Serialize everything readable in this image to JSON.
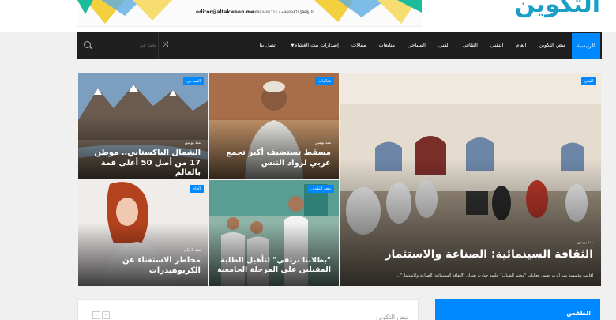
{
  "header": {
    "banner_contact_label": "للتواصل:",
    "banner_email": "editor@altakween.me",
    "banner_phones": "+96894481715 / +96894785904",
    "logo_text": "التكوين"
  },
  "nav": {
    "search_placeholder": "بحث عن",
    "menu": [
      "الرئيسية",
      "نبض التكوين",
      "العام",
      "التقني",
      "الثقافي",
      "الفني",
      "السياحي",
      "متابعات",
      "مقالات",
      "إصدارات بيت الغشام",
      "اتصل بنا"
    ]
  },
  "tiles": {
    "main": {
      "badge": "الفني",
      "date": "منذ يومين",
      "title": "الثقافة السينمائية: الصناعة والاستثمار",
      "excerpt": "أقامت مؤسسة بيت الزبير ضمن فعاليات \"مختبر الشباب\" جلسة حوارية بعنوان \"الثقافة السينمائية: الصناعة والاستثمار\"..."
    },
    "t1": {
      "badge": "فعاليات",
      "date": "منذ يومين",
      "title": "مسقط تستضيف أكبر تجمع عربي لرواد التنس"
    },
    "t2": {
      "badge": "السياحي",
      "date": "منذ يومين",
      "title": "الشمال الباكستاني.. موطن 17 من أصل 50 أعلى قمة بالعالم"
    },
    "t3": {
      "badge": "نبض التكوين",
      "title": "\"بطلابنا نرتقي\" لتأهيل الطلبة المقبلين على المرحلة الجامعية"
    },
    "t4": {
      "badge": "العام",
      "date": "منذ 3 أيام",
      "title": "مخاطر الاستغناء عن الكربوهيدرات"
    }
  },
  "bottom": {
    "block_title": "نبض التكوين",
    "prev": "‹",
    "next": "›",
    "weather_title": "الطقس"
  },
  "colors": {
    "accent": "#0088ff",
    "nav_bg": "#1f1f1f"
  }
}
